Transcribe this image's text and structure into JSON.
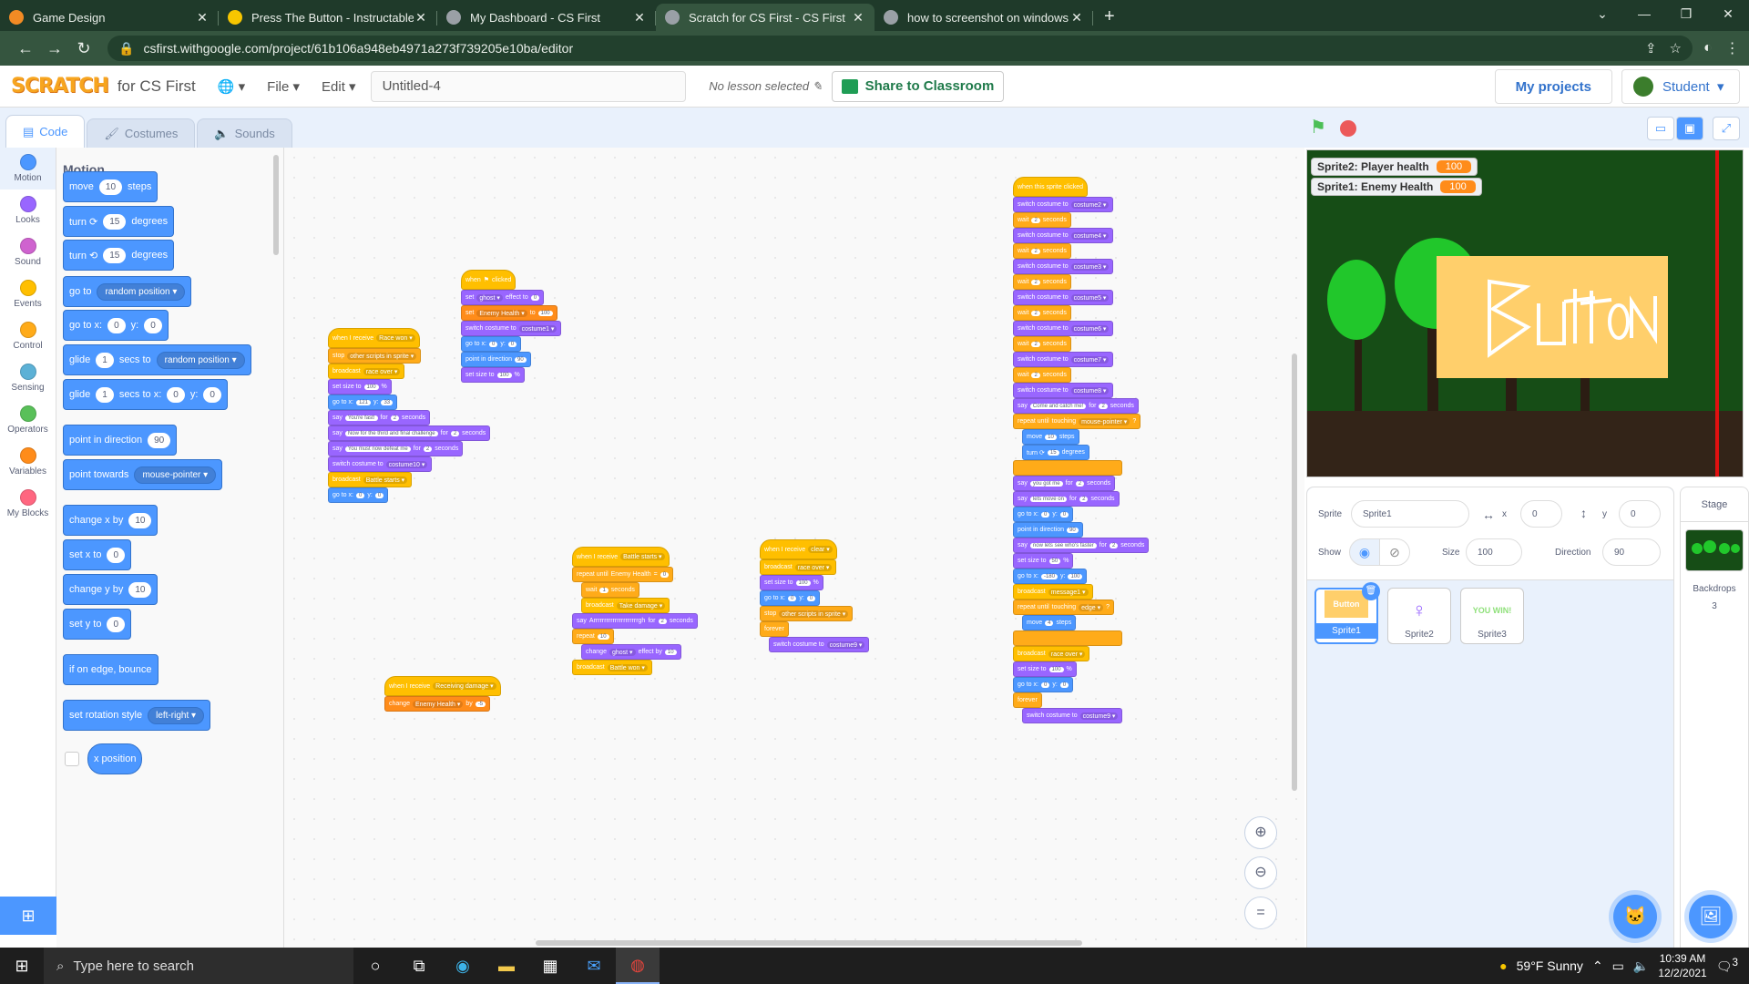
{
  "browser": {
    "tabs": [
      {
        "title": "Game Design",
        "color": "#f28b24"
      },
      {
        "title": "Press The Button - Instructables",
        "color": "#f7c600"
      },
      {
        "title": "My Dashboard - CS First",
        "color": "#9aa0a6"
      },
      {
        "title": "Scratch for CS First - CS First",
        "color": "#9aa0a6"
      },
      {
        "title": "how to screenshot on windows -",
        "color": "#9aa0a6"
      }
    ],
    "active_tab": 3,
    "url": "csfirst.withgoogle.com/project/61b106a948eb4971a273f739205e10ba/editor"
  },
  "menubar": {
    "logo": "SCRATCH",
    "for_label": "for CS First",
    "file": "File",
    "edit": "Edit",
    "project_title": "Untitled-4",
    "lesson": "No lesson selected",
    "share": "Share to Classroom",
    "my_projects": "My projects",
    "user": "Student"
  },
  "editor_tabs": [
    "Code",
    "Costumes",
    "Sounds"
  ],
  "categories": [
    {
      "label": "Motion",
      "color": "#4c97ff"
    },
    {
      "label": "Looks",
      "color": "#9966ff"
    },
    {
      "label": "Sound",
      "color": "#cf63cf"
    },
    {
      "label": "Events",
      "color": "#ffbf00"
    },
    {
      "label": "Control",
      "color": "#ffab19"
    },
    {
      "label": "Sensing",
      "color": "#5cb1d6"
    },
    {
      "label": "Operators",
      "color": "#59c059"
    },
    {
      "label": "Variables",
      "color": "#ff8c1a"
    },
    {
      "label": "My Blocks",
      "color": "#ff6680"
    }
  ],
  "palette": {
    "title": "Motion",
    "blocks": [
      {
        "parts": [
          "move",
          "10",
          "steps"
        ]
      },
      {
        "parts": [
          "turn ⟳",
          "15",
          "degrees"
        ]
      },
      {
        "parts": [
          "turn ⟲",
          "15",
          "degrees"
        ]
      },
      {
        "parts": [
          "go to",
          "random position ▾"
        ]
      },
      {
        "parts": [
          "go to x:",
          "0",
          "y:",
          "0"
        ]
      },
      {
        "parts": [
          "glide",
          "1",
          "secs to",
          "random position ▾"
        ]
      },
      {
        "parts": [
          "glide",
          "1",
          "secs to x:",
          "0",
          "y:",
          "0"
        ]
      },
      {
        "parts": [
          "point in direction",
          "90"
        ]
      },
      {
        "parts": [
          "point towards",
          "mouse-pointer ▾"
        ]
      },
      {
        "parts": [
          "change x by",
          "10"
        ]
      },
      {
        "parts": [
          "set x to",
          "0"
        ]
      },
      {
        "parts": [
          "change y by",
          "10"
        ]
      },
      {
        "parts": [
          "set y to",
          "0"
        ]
      },
      {
        "parts": [
          "if on edge, bounce"
        ]
      },
      {
        "parts": [
          "set rotation style",
          "left-right ▾"
        ]
      },
      {
        "parts": [
          "x position"
        ]
      }
    ]
  },
  "scripts": {
    "s1": [
      {
        "cls": "ev hat",
        "t": [
          "when I receive",
          "Race won ▾"
        ]
      },
      {
        "cls": "ct",
        "t": [
          "stop",
          "other scripts in sprite ▾"
        ]
      },
      {
        "cls": "ev",
        "t": [
          "broadcast",
          "race over ▾"
        ]
      },
      {
        "cls": "lk",
        "t": [
          "set size to",
          "100",
          "%"
        ]
      },
      {
        "cls": "mo",
        "t": [
          "go to x:",
          "121",
          "y:",
          "33"
        ]
      },
      {
        "cls": "lk",
        "t": [
          "say",
          "You're fast!",
          "for",
          "2",
          "seconds"
        ]
      },
      {
        "cls": "lk",
        "t": [
          "say",
          "Now for the third and final challenge",
          "for",
          "2",
          "seconds"
        ]
      },
      {
        "cls": "lk",
        "t": [
          "say",
          "You must now defeat me",
          "for",
          "2",
          "seconds"
        ]
      },
      {
        "cls": "lk",
        "t": [
          "switch costume to",
          "costume10 ▾"
        ]
      },
      {
        "cls": "ev",
        "t": [
          "broadcast",
          "Battle starts ▾"
        ]
      },
      {
        "cls": "mo",
        "t": [
          "go to x:",
          "0",
          "y:",
          "0"
        ]
      }
    ],
    "s2": [
      {
        "cls": "ev hat",
        "t": [
          "when",
          "⚑",
          "clicked"
        ]
      },
      {
        "cls": "lk",
        "t": [
          "set",
          "ghost ▾",
          "effect to",
          "0"
        ]
      },
      {
        "cls": "vr",
        "t": [
          "set",
          "Enemy Health ▾",
          "to",
          "100"
        ]
      },
      {
        "cls": "lk",
        "t": [
          "switch costume to",
          "costume1 ▾"
        ]
      },
      {
        "cls": "mo",
        "t": [
          "go to x:",
          "0",
          "y:",
          "0"
        ]
      },
      {
        "cls": "mo",
        "t": [
          "point in direction",
          "90"
        ]
      },
      {
        "cls": "lk",
        "t": [
          "set size to",
          "100",
          "%"
        ]
      }
    ],
    "s3": [
      {
        "cls": "ev hat",
        "t": [
          "when I receive",
          "Receiving damage ▾"
        ]
      },
      {
        "cls": "vr",
        "t": [
          "change",
          "Enemy Health ▾",
          "by",
          "-5"
        ]
      }
    ],
    "s4": [
      {
        "cls": "ev hat",
        "t": [
          "when I receive",
          "Battle starts ▾"
        ]
      },
      {
        "cls": "ct",
        "t": [
          "repeat until",
          "Enemy Health",
          "=",
          "0"
        ]
      },
      {
        "cls": "ct",
        "t": [
          "wait",
          "1",
          "seconds"
        ],
        "indent": true
      },
      {
        "cls": "ev",
        "t": [
          "broadcast",
          "Take damage ▾"
        ],
        "indent": true
      },
      {
        "cls": "lk",
        "t": [
          "say",
          "Arrrrrrrrrrrrrrrrrrrrrgh",
          "for",
          "2",
          "seconds"
        ]
      },
      {
        "cls": "ct",
        "t": [
          "repeat",
          "10"
        ]
      },
      {
        "cls": "lk",
        "t": [
          "change",
          "ghost ▾",
          "effect by",
          "10"
        ],
        "indent": true
      },
      {
        "cls": "ev",
        "t": [
          "broadcast",
          "Battle won ▾"
        ]
      }
    ],
    "s5": [
      {
        "cls": "ev hat",
        "t": [
          "when I receive",
          "clear ▾"
        ]
      },
      {
        "cls": "ev",
        "t": [
          "broadcast",
          "race over ▾"
        ]
      },
      {
        "cls": "lk",
        "t": [
          "set size to",
          "100",
          "%"
        ]
      },
      {
        "cls": "mo",
        "t": [
          "go to x:",
          "0",
          "y:",
          "0"
        ]
      },
      {
        "cls": "ct",
        "t": [
          "stop",
          "other scripts in sprite ▾"
        ]
      },
      {
        "cls": "ct",
        "t": [
          "forever"
        ]
      },
      {
        "cls": "lk",
        "t": [
          "switch costume to",
          "costume9 ▾"
        ],
        "indent": true
      }
    ],
    "s6": [
      {
        "cls": "ev hat",
        "t": [
          "when this sprite clicked"
        ]
      },
      {
        "cls": "lk",
        "t": [
          "switch costume to",
          "costume2 ▾"
        ]
      },
      {
        "cls": "ct",
        "t": [
          "wait",
          "2",
          "seconds"
        ]
      },
      {
        "cls": "lk",
        "t": [
          "switch costume to",
          "costume4 ▾"
        ]
      },
      {
        "cls": "ct",
        "t": [
          "wait",
          "2",
          "seconds"
        ]
      },
      {
        "cls": "lk",
        "t": [
          "switch costume to",
          "costume3 ▾"
        ]
      },
      {
        "cls": "ct",
        "t": [
          "wait",
          "2",
          "seconds"
        ]
      },
      {
        "cls": "lk",
        "t": [
          "switch costume to",
          "costume5 ▾"
        ]
      },
      {
        "cls": "ct",
        "t": [
          "wait",
          "2",
          "seconds"
        ]
      },
      {
        "cls": "lk",
        "t": [
          "switch costume to",
          "costume6 ▾"
        ]
      },
      {
        "cls": "ct",
        "t": [
          "wait",
          "2",
          "seconds"
        ]
      },
      {
        "cls": "lk",
        "t": [
          "switch costume to",
          "costume7 ▾"
        ]
      },
      {
        "cls": "ct",
        "t": [
          "wait",
          "2",
          "seconds"
        ]
      },
      {
        "cls": "lk",
        "t": [
          "switch costume to",
          "costume8 ▾"
        ]
      },
      {
        "cls": "lk",
        "t": [
          "say",
          "Come and catch me!",
          "for",
          "2",
          "seconds"
        ]
      },
      {
        "cls": "ct",
        "t": [
          "repeat until",
          "touching",
          "mouse-pointer ▾",
          "?"
        ]
      },
      {
        "cls": "mo",
        "t": [
          "move",
          "10",
          "steps"
        ],
        "indent": true
      },
      {
        "cls": "mo",
        "t": [
          "turn ⟳",
          "15",
          "degrees"
        ],
        "indent": true
      },
      {
        "cls": "ct",
        "t": [
          ""
        ]
      },
      {
        "cls": "lk",
        "t": [
          "say",
          "you got me",
          "for",
          "2",
          "seconds"
        ]
      },
      {
        "cls": "lk",
        "t": [
          "say",
          "lets move on",
          "for",
          "2",
          "seconds"
        ]
      },
      {
        "cls": "mo",
        "t": [
          "go to x:",
          "0",
          "y:",
          "0"
        ]
      },
      {
        "cls": "mo",
        "t": [
          "point in direction",
          "90"
        ]
      },
      {
        "cls": "lk",
        "t": [
          "say",
          "now lets see who's faster",
          "for",
          "2",
          "seconds"
        ]
      },
      {
        "cls": "lk",
        "t": [
          "set size to",
          "50",
          "%"
        ]
      },
      {
        "cls": "mo",
        "t": [
          "go to x:",
          "-180",
          "y:",
          "100"
        ]
      },
      {
        "cls": "ev",
        "t": [
          "broadcast",
          "message1 ▾"
        ]
      },
      {
        "cls": "ct",
        "t": [
          "repeat until",
          "touching",
          "edge ▾",
          "?"
        ]
      },
      {
        "cls": "mo",
        "t": [
          "move",
          "4",
          "steps"
        ],
        "indent": true
      },
      {
        "cls": "ct",
        "t": [
          ""
        ]
      },
      {
        "cls": "ev",
        "t": [
          "broadcast",
          "race over ▾"
        ]
      },
      {
        "cls": "lk",
        "t": [
          "set size to",
          "100",
          "%"
        ]
      },
      {
        "cls": "mo",
        "t": [
          "go to x:",
          "0",
          "y:",
          "0"
        ]
      },
      {
        "cls": "ct",
        "t": [
          "forever"
        ]
      },
      {
        "cls": "lk",
        "t": [
          "switch costume to",
          "costume9 ▾"
        ],
        "indent": true
      }
    ]
  },
  "stage": {
    "monitors": [
      {
        "label": "Sprite2: Player health",
        "value": "100"
      },
      {
        "label": "Sprite1: Enemy Health",
        "value": "100"
      }
    ],
    "sign_text": "Button"
  },
  "sprite_info": {
    "sprite_label": "Sprite",
    "sprite_name": "Sprite1",
    "x_label": "x",
    "x": "0",
    "y_label": "y",
    "y": "0",
    "show_label": "Show",
    "size_label": "Size",
    "size": "100",
    "direction_label": "Direction",
    "direction": "90"
  },
  "sprites": [
    {
      "name": "Sprite1",
      "thumb": "Button"
    },
    {
      "name": "Sprite2",
      "thumb": ""
    },
    {
      "name": "Sprite3",
      "thumb": "YOU WIN!"
    }
  ],
  "stage_pane": {
    "title": "Stage",
    "backdrops_label": "Backdrops",
    "backdrops_count": "3"
  },
  "taskbar": {
    "search_placeholder": "Type here to search",
    "weather": "59°F  Sunny",
    "time": "10:39 AM",
    "date": "12/2/2021",
    "notif_count": "3"
  }
}
